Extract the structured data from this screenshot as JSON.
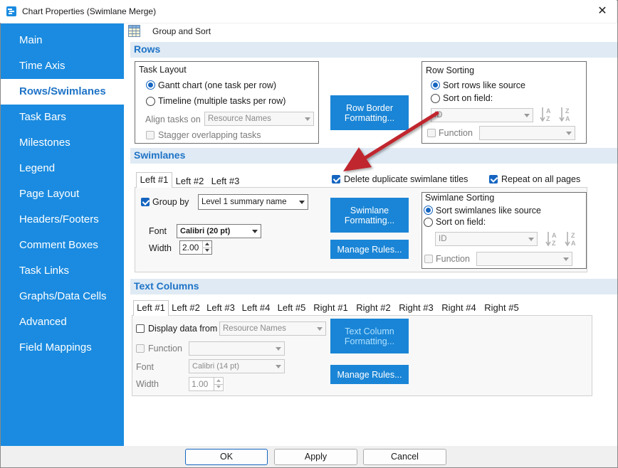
{
  "window": {
    "title": "Chart Properties (Swimlane Merge)",
    "close_glyph": "✕"
  },
  "sidebar": {
    "items": [
      {
        "label": "Main"
      },
      {
        "label": "Time Axis"
      },
      {
        "label": "Rows/Swimlanes"
      },
      {
        "label": "Task Bars"
      },
      {
        "label": "Milestones"
      },
      {
        "label": "Legend"
      },
      {
        "label": "Page Layout"
      },
      {
        "label": "Headers/Footers"
      },
      {
        "label": "Comment Boxes"
      },
      {
        "label": "Task Links"
      },
      {
        "label": "Graphs/Data Cells"
      },
      {
        "label": "Advanced"
      },
      {
        "label": "Field Mappings"
      }
    ],
    "active": "Rows/Swimlanes"
  },
  "toolbar": {
    "group_sort_label": "Group and Sort"
  },
  "rows": {
    "section_title": "Rows",
    "task_layout": {
      "title": "Task Layout",
      "gantt_label": "Gantt chart (one task per row)",
      "timeline_label": "Timeline (multiple tasks per row)",
      "align_label": "Align tasks on",
      "align_value": "Resource Names",
      "stagger_label": "Stagger overlapping tasks"
    },
    "row_border_button": [
      "Row Border",
      "Formatting..."
    ],
    "row_sorting": {
      "title": "Row Sorting",
      "like_source_label": "Sort rows like source",
      "on_field_label": "Sort on field:",
      "field_value": "ID",
      "function_label": "Function",
      "function_value": ""
    }
  },
  "swimlanes": {
    "section_title": "Swimlanes",
    "delete_dup_label": "Delete duplicate swimlane titles",
    "repeat_label": "Repeat on all pages",
    "tabs": [
      "Left #1",
      "Left #2",
      "Left #3"
    ],
    "group_by_label": "Group by",
    "group_by_value": "Level 1 summary name",
    "font_label": "Font",
    "font_value": "Calibri (20 pt)",
    "width_label": "Width",
    "width_value": "2.00",
    "formatting_button": [
      "Swimlane",
      "Formatting..."
    ],
    "manage_rules_label": "Manage Rules...",
    "sorting": {
      "title": "Swimlane Sorting",
      "like_source_label": "Sort swimlanes like source",
      "on_field_label": "Sort on field:",
      "field_value": "ID",
      "function_label": "Function",
      "function_value": ""
    }
  },
  "text_columns": {
    "section_title": "Text Columns",
    "tabs": [
      "Left #1",
      "Left #2",
      "Left #3",
      "Left #4",
      "Left #5",
      "Right #1",
      "Right #2",
      "Right #3",
      "Right #4",
      "Right #5"
    ],
    "display_from_label": "Display data from",
    "display_from_value": "Resource Names",
    "function_label": "Function",
    "function_value": "",
    "font_label": "Font",
    "font_value": "Calibri (14 pt)",
    "width_label": "Width",
    "width_value": "1.00",
    "formatting_button": [
      "Text Column",
      "Formatting..."
    ],
    "manage_rules_label": "Manage Rules..."
  },
  "footer": {
    "ok_label": "OK",
    "apply_label": "Apply",
    "cancel_label": "Cancel"
  },
  "colors": {
    "accent": "#1a8be0",
    "button": "#1a85d6",
    "arrow": "#c0272d",
    "section_bg": "#dfeaf4"
  }
}
